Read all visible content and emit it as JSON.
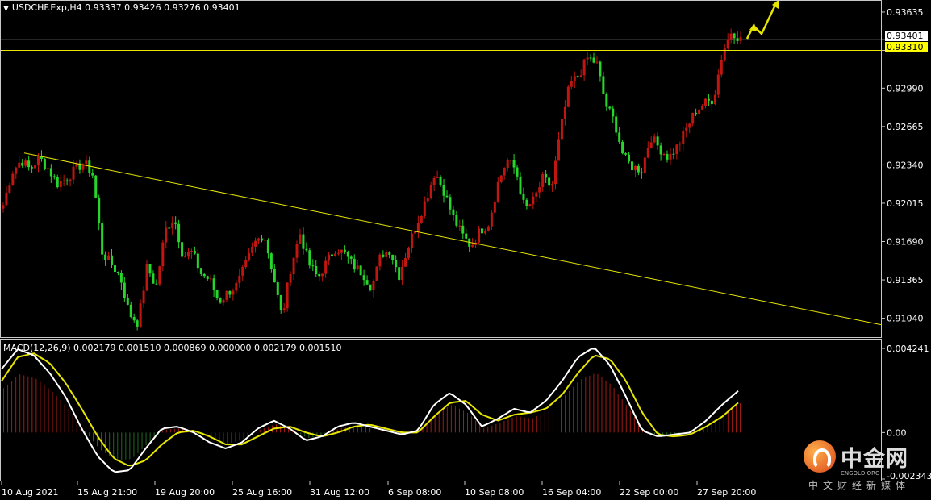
{
  "header": {
    "symbol_info": "USDCHF.Exp,H4  0.93337 0.93426 0.93276 0.93401",
    "macd_info": "MACD(12,26,9) 0.002179 0.001510 0.000869 0.000000 0.002179 0.001510"
  },
  "price_tags": {
    "bid": "0.93401",
    "level": "0.93310"
  },
  "watermark": {
    "title": "中金网",
    "sub": "CNGOLD.ORG",
    "cn": "中文财经新媒体"
  },
  "colors": {
    "bull": "#c0160f",
    "bear": "#26d62a",
    "macd_line": "#ffffff",
    "signal_line": "#e6e600",
    "hist_pos": "#a31b14",
    "hist_neg": "#1f6b1f",
    "guide": "#e6e600",
    "grid": "#808080"
  },
  "chart_data": [
    {
      "type": "candlestick",
      "title": "USDCHF.Exp,H4",
      "price_ticks": [
        "0.93635",
        "0.93401",
        "0.93310",
        "0.92990",
        "0.92665",
        "0.92340",
        "0.92015",
        "0.91690",
        "0.91365",
        "0.91040"
      ],
      "ylim": [
        0.9088,
        0.9371
      ],
      "x_ticks": [
        "10 Aug 2021",
        "15 Aug 21:00",
        "19 Aug 20:00",
        "25 Aug 16:00",
        "31 Aug 12:00",
        "6 Sep 08:00",
        "10 Sep 08:00",
        "16 Sep 04:00",
        "22 Sep 00:00",
        "27 Sep 20:00"
      ],
      "close_path": [
        0.92,
        0.9228,
        0.9238,
        0.923,
        0.924,
        0.9231,
        0.9218,
        0.9222,
        0.923,
        0.9236,
        0.9225,
        0.916,
        0.915,
        0.914,
        0.9108,
        0.91,
        0.9148,
        0.913,
        0.9178,
        0.919,
        0.9156,
        0.916,
        0.9142,
        0.9136,
        0.9118,
        0.9126,
        0.9132,
        0.915,
        0.9168,
        0.9176,
        0.9142,
        0.9104,
        0.9148,
        0.9176,
        0.915,
        0.9138,
        0.9152,
        0.9164,
        0.9158,
        0.9148,
        0.9142,
        0.913,
        0.9158,
        0.9162,
        0.914,
        0.9164,
        0.9185,
        0.9205,
        0.9228,
        0.9212,
        0.919,
        0.9175,
        0.9165,
        0.9178,
        0.9185,
        0.9218,
        0.9238,
        0.923,
        0.9196,
        0.9204,
        0.9222,
        0.9215,
        0.9265,
        0.9302,
        0.931,
        0.9325,
        0.932,
        0.9285,
        0.927,
        0.924,
        0.9232,
        0.923,
        0.9258,
        0.9248,
        0.924,
        0.925,
        0.9265,
        0.928,
        0.9286,
        0.929,
        0.933,
        0.9348,
        0.934
      ],
      "guides": {
        "trendline": [
          0.9244,
          0.90985
        ],
        "resistance_level": 0.9331,
        "support_level": 0.91
      }
    },
    {
      "type": "line+bar",
      "title": "MACD(12,26,9)",
      "values": {
        "macd": 0.002179,
        "signal": 0.00151,
        "histogram": 0.000869
      },
      "y_ticks": [
        "0.004241",
        "0.00",
        "-0.002343"
      ],
      "ylim": [
        -0.002343,
        0.004241
      ],
      "series": [
        {
          "name": "MACD",
          "values": [
            0.0032,
            0.0042,
            0.0039,
            0.003,
            0.0018,
            0.0002,
            -0.0012,
            -0.002,
            -0.0019,
            -0.0008,
            0.0002,
            0.0003,
            0.0,
            -0.0005,
            -0.0008,
            -0.0005,
            0.0002,
            0.0006,
            0.0002,
            -0.0004,
            -0.0002,
            0.0003,
            0.0005,
            0.0003,
            0.0001,
            -0.0001,
            0.0001,
            0.0014,
            0.002,
            0.0014,
            0.0003,
            0.0007,
            0.0012,
            0.001,
            0.0016,
            0.0026,
            0.0038,
            0.0043,
            0.0034,
            0.0018,
            0.0001,
            -0.0002,
            -0.0001,
            0.0,
            0.0006,
            0.0014,
            0.0021
          ]
        },
        {
          "name": "Signal",
          "values": [
            0.0026,
            0.0038,
            0.004,
            0.0035,
            0.0025,
            0.0012,
            -0.0002,
            -0.0013,
            -0.0017,
            -0.0014,
            -0.0006,
            0.0,
            0.0001,
            -0.0002,
            -0.0006,
            -0.0006,
            -0.0002,
            0.0002,
            0.0003,
            0.0,
            -0.0002,
            0.0,
            0.0003,
            0.0004,
            0.0002,
            0.0,
            0.0,
            0.0008,
            0.0015,
            0.0016,
            0.0009,
            0.0006,
            0.0009,
            0.001,
            0.0012,
            0.0019,
            0.003,
            0.0039,
            0.0037,
            0.0026,
            0.001,
            -0.0001,
            -0.0002,
            -0.0001,
            0.0003,
            0.0008,
            0.0015
          ]
        }
      ]
    }
  ]
}
